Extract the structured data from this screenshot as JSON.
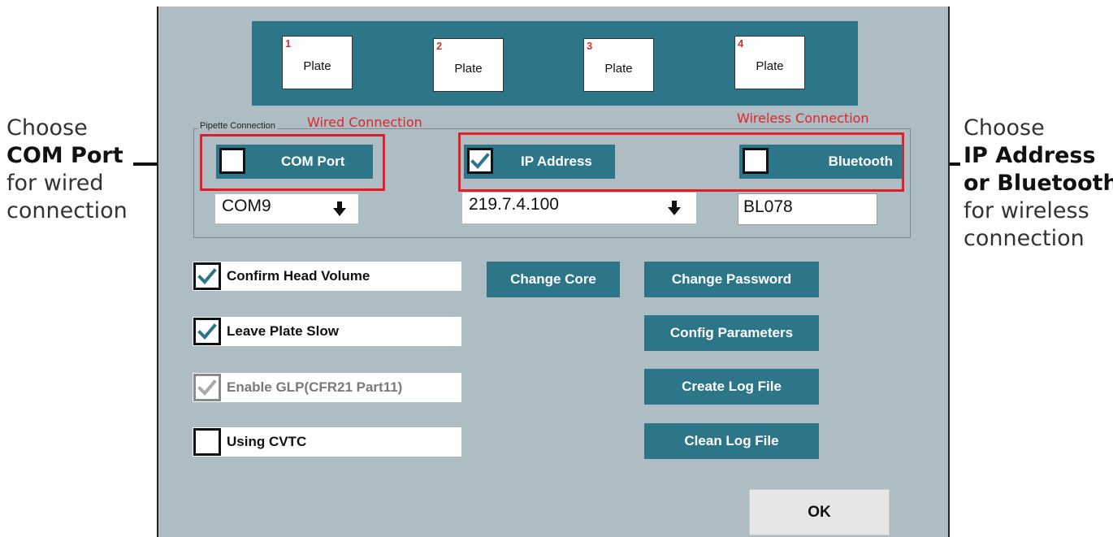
{
  "annotations": {
    "left": {
      "line1": "Choose",
      "line2": "COM Port",
      "line3": "for wired",
      "line4": "connection"
    },
    "right": {
      "line1": "Choose",
      "line2": "IP Address",
      "line3": "or Bluetooth",
      "line4": "for wireless",
      "line5": "connection"
    }
  },
  "plates": [
    {
      "number": "1",
      "label": "Plate"
    },
    {
      "number": "2",
      "label": "Plate"
    },
    {
      "number": "3",
      "label": "Plate"
    },
    {
      "number": "4",
      "label": "Plate"
    }
  ],
  "pipette_connection": {
    "group_label": "Pipette Connection",
    "wired_label": "Wired Connection",
    "wireless_label": "Wireless Connection",
    "com_port": {
      "label": "COM Port",
      "checked": false,
      "value": "COM9"
    },
    "ip_address": {
      "label": "IP Address",
      "checked": true,
      "value": "219.7.4.100"
    },
    "bluetooth": {
      "label": "Bluetooth",
      "checked": false,
      "value": "BL078"
    }
  },
  "options": [
    {
      "label": "Confirm Head Volume",
      "checked": true,
      "enabled": true
    },
    {
      "label": "Leave Plate Slow",
      "checked": true,
      "enabled": true
    },
    {
      "label": "Enable GLP(CFR21 Part11)",
      "checked": true,
      "enabled": false
    },
    {
      "label": "Using CVTC",
      "checked": false,
      "enabled": true
    }
  ],
  "buttons": {
    "change_core": "Change Core",
    "change_password": "Change Password",
    "config_parameters": "Config Parameters",
    "create_log_file": "Create Log File",
    "clean_log_file": "Clean Log File",
    "ok": "OK"
  },
  "icons": {
    "check": "check-icon",
    "dropdown": "arrow-down-icon",
    "pointer_arrow": "arrow-icon"
  },
  "colors": {
    "dialog_bg": "#aebcc3",
    "teal": "#2d7689",
    "highlight_red": "#e21f26",
    "plate_number_red": "#d2353a"
  }
}
